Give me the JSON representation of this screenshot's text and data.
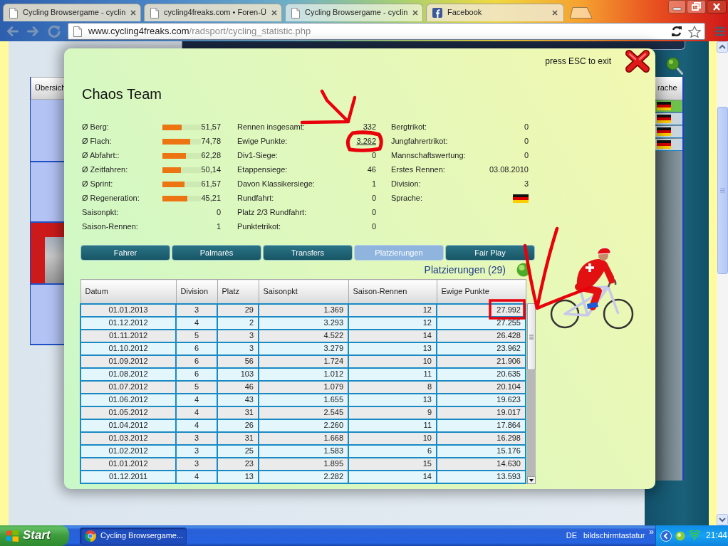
{
  "browser": {
    "tabs": [
      {
        "title": "Cycling Browsergame - cyclin",
        "kind": "page",
        "selected": false
      },
      {
        "title": "cycling4freaks.com • Foren-Ü",
        "kind": "page",
        "selected": false
      },
      {
        "title": "Cycling Browsergame - cyclin",
        "kind": "page",
        "selected": true
      },
      {
        "title": "Facebook",
        "kind": "facebook",
        "selected": false
      }
    ],
    "address": {
      "host": "www.cycling4freaks.com",
      "path": "/radsport/cycling_statistic.php"
    }
  },
  "background_page": {
    "left_panel": {
      "header": "Übersich"
    },
    "right_panel": {
      "header": "rache",
      "rows": [
        {
          "highlighted": true
        },
        {
          "highlighted": false
        },
        {
          "highlighted": false
        },
        {
          "highlighted": false
        }
      ]
    }
  },
  "dialog": {
    "hint": "press ESC to exit",
    "title": "Chaos Team",
    "stats_columns": [
      [
        {
          "kind": "skill",
          "label": "Ø Berg:",
          "level": 0.5,
          "value": "51,57"
        },
        {
          "kind": "skill",
          "label": "Ø Flach:",
          "level": 0.72,
          "value": "74,78"
        },
        {
          "kind": "skill",
          "label": "Ø Abfahrt::",
          "level": 0.61,
          "value": "62,28"
        },
        {
          "kind": "skill",
          "label": "Ø Zeitfahren:",
          "level": 0.49,
          "value": "50,14"
        },
        {
          "kind": "skill",
          "label": "Ø Sprint:",
          "level": 0.57,
          "value": "61,57"
        },
        {
          "kind": "skill",
          "label": "Ø Regeneration:",
          "level": 0.64,
          "value": "45,21"
        },
        {
          "kind": "plain",
          "label": "Saisonpkt:",
          "value": "0"
        },
        {
          "kind": "plain",
          "label": "Saison-Rennen:",
          "value": "1"
        }
      ],
      [
        {
          "kind": "plain",
          "label": "Rennen insgesamt:",
          "value": "332"
        },
        {
          "kind": "link",
          "label": "Ewige Punkte:",
          "value": "3.262"
        },
        {
          "kind": "plain",
          "label": "Div1-Siege:",
          "value": "0"
        },
        {
          "kind": "plain",
          "label": "Etappensiege:",
          "value": "46"
        },
        {
          "kind": "plain",
          "label": "Davon Klassikersiege:",
          "value": "1"
        },
        {
          "kind": "plain",
          "label": "Rundfahrt:",
          "value": "0"
        },
        {
          "kind": "plain",
          "label": "Platz 2/3 Rundfahrt:",
          "value": "0"
        },
        {
          "kind": "plain",
          "label": "Punktetrikot:",
          "value": "0"
        }
      ],
      [
        {
          "kind": "plain",
          "label": "Bergtrikot:",
          "value": "0"
        },
        {
          "kind": "plain",
          "label": "Jungfahrertrikot:",
          "value": "0"
        },
        {
          "kind": "plain",
          "label": "Mannschaftswertung:",
          "value": "0"
        },
        {
          "kind": "plain",
          "label": "Erstes Rennen:",
          "value": "03.08.2010"
        },
        {
          "kind": "plain",
          "label": "Division:",
          "value": "3"
        },
        {
          "kind": "flag",
          "label": "Sprache:"
        }
      ]
    ],
    "tabs": [
      {
        "label": "Fahrer",
        "selected": false
      },
      {
        "label": "Palmarès",
        "selected": false
      },
      {
        "label": "Transfers",
        "selected": false
      },
      {
        "label": "Platzierungen",
        "selected": true
      },
      {
        "label": "Fair Play",
        "selected": false
      }
    ],
    "heading": "Platzierungen (29)",
    "table": {
      "columns": [
        "Datum",
        "Division",
        "Platz",
        "Saisonpkt",
        "Saison-Rennen",
        "Ewige Punkte"
      ],
      "rows": [
        [
          "01.01.2013",
          "3",
          "29",
          "1.369",
          "12",
          "27.992"
        ],
        [
          "01.12.2012",
          "4",
          "2",
          "3.293",
          "12",
          "27.255"
        ],
        [
          "01.11.2012",
          "5",
          "3",
          "4.522",
          "14",
          "26.428"
        ],
        [
          "01.10.2012",
          "6",
          "3",
          "3.279",
          "13",
          "23.962"
        ],
        [
          "01.09.2012",
          "6",
          "56",
          "1.724",
          "10",
          "21.906"
        ],
        [
          "01.08.2012",
          "6",
          "103",
          "1.012",
          "11",
          "20.635"
        ],
        [
          "01.07.2012",
          "5",
          "46",
          "1.079",
          "8",
          "20.104"
        ],
        [
          "01.06.2012",
          "4",
          "43",
          "1.655",
          "13",
          "19.623"
        ],
        [
          "01.05.2012",
          "4",
          "31",
          "2.545",
          "9",
          "19.017"
        ],
        [
          "01.04.2012",
          "4",
          "26",
          "2.260",
          "11",
          "17.864"
        ],
        [
          "01.03.2012",
          "3",
          "31",
          "1.668",
          "10",
          "16.298"
        ],
        [
          "01.02.2012",
          "3",
          "25",
          "1.583",
          "6",
          "15.176"
        ],
        [
          "01.01.2012",
          "3",
          "23",
          "1.895",
          "15",
          "14.630"
        ],
        [
          "01.12.2011",
          "4",
          "13",
          "2.282",
          "14",
          "13.593"
        ]
      ]
    }
  },
  "annotations": [
    {
      "kind": "arrow"
    },
    {
      "kind": "ring"
    },
    {
      "kind": "frame"
    },
    {
      "kind": "check"
    }
  ],
  "taskbar": {
    "start": "Start",
    "tasks": [
      {
        "title": "Cycling Browsergame...",
        "selected": true
      }
    ],
    "language": "DE",
    "toolbar": "bildschirmtastatur",
    "more": "»",
    "clock": "21:44"
  }
}
